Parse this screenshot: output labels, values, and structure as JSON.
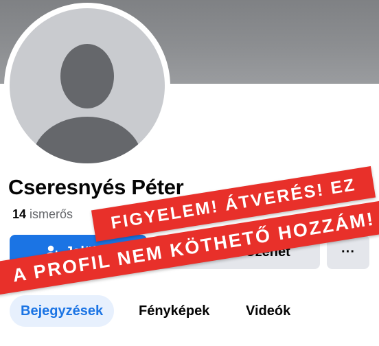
{
  "profile": {
    "name": "Cseresnyés Péter",
    "friends_count": "14",
    "friends_label": "ismerős"
  },
  "actions": {
    "primary_label": "Jelölés",
    "secondary_label": "Üzenet",
    "more_label": "···"
  },
  "tabs": [
    {
      "label": "Bejegyzések",
      "active": true
    },
    {
      "label": "Fényképek",
      "active": false
    },
    {
      "label": "Videók",
      "active": false
    }
  ],
  "warning": {
    "line1": "FIGYELEM! ÁTVERÉS! EZ",
    "line2": "A PROFIL NEM KÖTHETŐ HOZZÁM!",
    "color": "#e8302a"
  },
  "colors": {
    "accent": "#1b74e4",
    "cover": "#8c8e91",
    "button_secondary": "#e4e6eb"
  }
}
